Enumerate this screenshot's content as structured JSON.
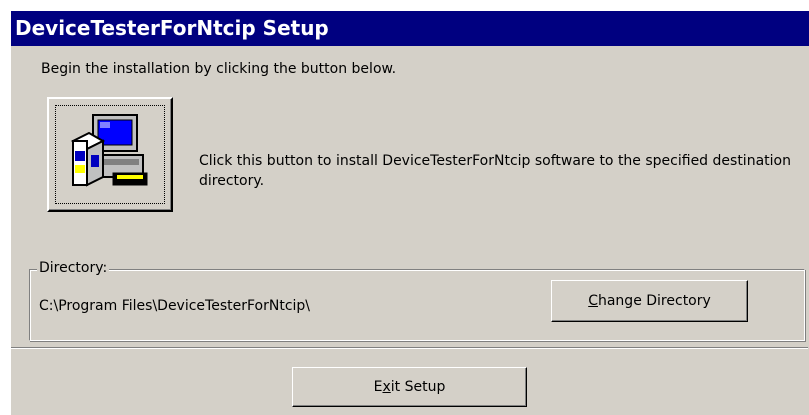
{
  "window": {
    "title": "DeviceTesterForNtcip Setup"
  },
  "instruction": "Begin the installation by clicking the button below.",
  "install": {
    "icon": "computer-install-icon",
    "description": "Click this button to install DeviceTesterForNtcip software to the specified destination directory."
  },
  "directory": {
    "group_label": "Directory:",
    "path": "C:\\Program Files\\DeviceTesterForNtcip\\",
    "change_button": {
      "label_pre": "",
      "label_key": "C",
      "label_post": "hange Directory"
    }
  },
  "exit_button": {
    "label_pre": "E",
    "label_key": "x",
    "label_post": "it Setup"
  },
  "colors": {
    "title_bar": "#000080",
    "window_face": "#d4d0c8"
  }
}
